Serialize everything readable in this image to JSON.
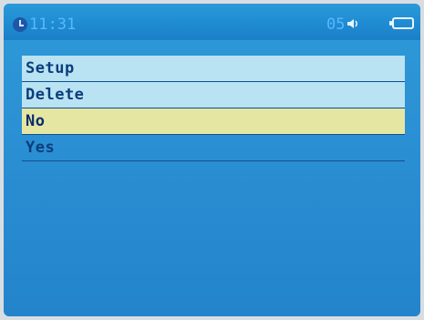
{
  "status_bar": {
    "clock_icon": "clock-icon",
    "time": "11:31",
    "volume": "05",
    "volume_icon": "speaker-icon",
    "battery_icon": "battery-icon"
  },
  "menu": {
    "items": [
      {
        "label": "Setup"
      },
      {
        "label": "Delete"
      },
      {
        "label": "No"
      },
      {
        "label": "Yes"
      }
    ],
    "selected_label": "No"
  },
  "colors": {
    "screen_blue": "#2b8fd3",
    "row_highlight": "#b9e3f2",
    "selected_row": "#e6e6a3",
    "menu_text": "#0b3d7e",
    "status_text": "#57b8ff"
  }
}
